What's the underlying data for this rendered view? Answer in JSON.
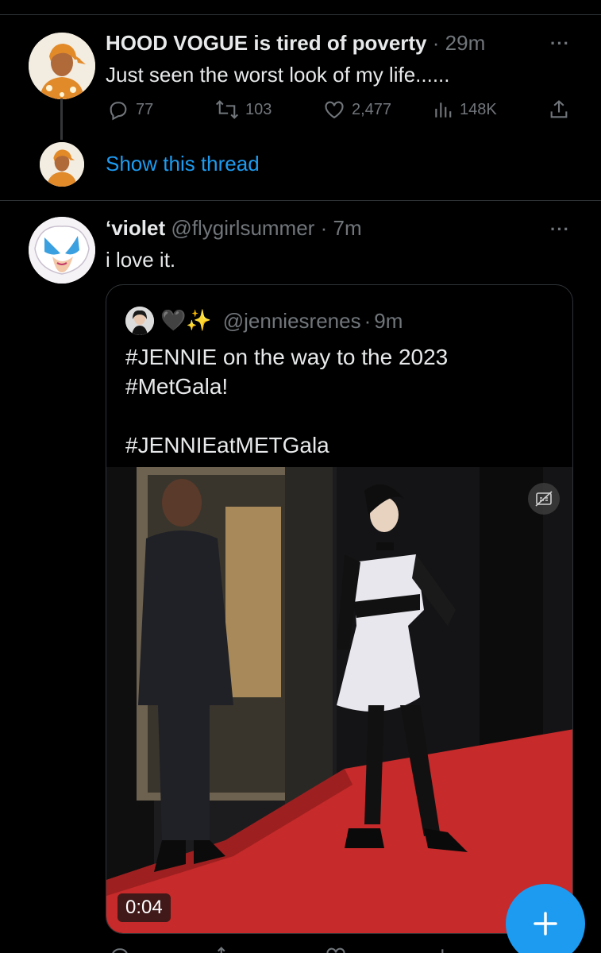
{
  "post1": {
    "display_name": "HOOD VOGUE is tired of poverty",
    "separator": "·",
    "time": "29m",
    "text": "Just seen the worst look of my life......",
    "replies": "77",
    "reposts": "103",
    "likes": "2,477",
    "views": "148K",
    "show_thread_label": "Show this thread"
  },
  "post2": {
    "display_name": "ʻviolet",
    "handle": "@flygirlsummer",
    "separator": "·",
    "time": "7m",
    "text": "i love it."
  },
  "quote": {
    "emoji": "🖤✨",
    "handle": "@jenniesrenes",
    "separator": "·",
    "time": "9m",
    "text_lines": [
      "#JENNIE on the way to the 2023",
      "#MetGala!",
      "",
      "#JENNIEatMETGala"
    ],
    "video_duration": "0:04"
  },
  "fab_label": "+",
  "colors": {
    "background": "#000000",
    "text": "#e7e9ea",
    "muted": "#71767b",
    "accent": "#1d9bf0",
    "divider": "#2f3336",
    "carpet": "#c62a2a"
  },
  "icons": [
    "reply-icon",
    "repost-icon",
    "like-icon",
    "views-icon",
    "share-icon",
    "more-icon",
    "captions-icon",
    "compose-icon"
  ]
}
